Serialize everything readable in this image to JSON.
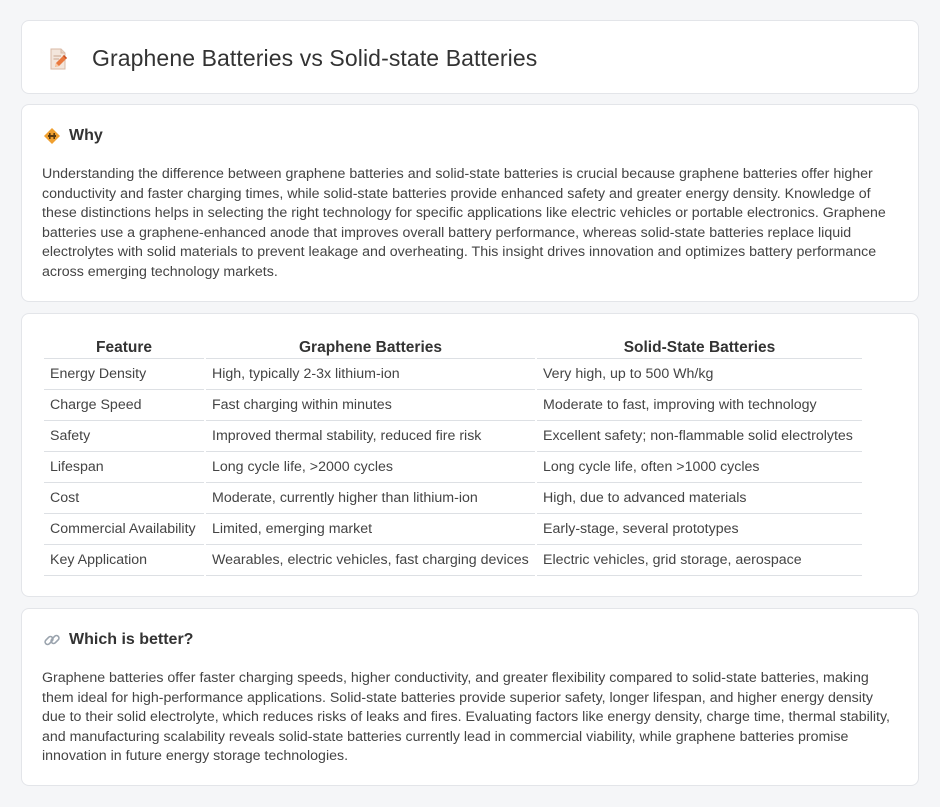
{
  "header": {
    "title": "Graphene Batteries vs Solid-state Batteries",
    "icon": "document-pencil-icon"
  },
  "why": {
    "heading": "Why",
    "icon": "warning-sign-icon",
    "text": "Understanding the difference between graphene batteries and solid-state batteries is crucial because graphene batteries offer higher conductivity and faster charging times, while solid-state batteries provide enhanced safety and greater energy density. Knowledge of these distinctions helps in selecting the right technology for specific applications like electric vehicles or portable electronics. Graphene batteries use a graphene-enhanced anode that improves overall battery performance, whereas solid-state batteries replace liquid electrolytes with solid materials to prevent leakage and overheating. This insight drives innovation and optimizes battery performance across emerging technology markets."
  },
  "table": {
    "headers": [
      "Feature",
      "Graphene Batteries",
      "Solid-State Batteries"
    ],
    "rows": [
      [
        "Energy Density",
        "High, typically 2-3x lithium-ion",
        "Very high, up to 500 Wh/kg"
      ],
      [
        "Charge Speed",
        "Fast charging within minutes",
        "Moderate to fast, improving with technology"
      ],
      [
        "Safety",
        "Improved thermal stability, reduced fire risk",
        "Excellent safety; non-flammable solid electrolytes"
      ],
      [
        "Lifespan",
        "Long cycle life, >2000 cycles",
        "Long cycle life, often >1000 cycles"
      ],
      [
        "Cost",
        "Moderate, currently higher than lithium-ion",
        "High, due to advanced materials"
      ],
      [
        "Commercial Availability",
        "Limited, emerging market",
        "Early-stage, several prototypes"
      ],
      [
        "Key Application",
        "Wearables, electric vehicles, fast charging devices",
        "Electric vehicles, grid storage, aerospace"
      ]
    ]
  },
  "better": {
    "heading": "Which is better?",
    "icon": "link-icon",
    "text": "Graphene batteries offer faster charging speeds, higher conductivity, and greater flexibility compared to solid-state batteries, making them ideal for high-performance applications. Solid-state batteries provide superior safety, longer lifespan, and higher energy density due to their solid electrolyte, which reduces risks of leaks and fires. Evaluating factors like energy density, charge time, thermal stability, and manufacturing scalability reveals solid-state batteries currently lead in commercial viability, while graphene batteries promise innovation in future energy storage technologies."
  },
  "colors": {
    "accent_orange": "#f0a030",
    "border": "#e3e5e9",
    "background": "#f5f6f8"
  }
}
